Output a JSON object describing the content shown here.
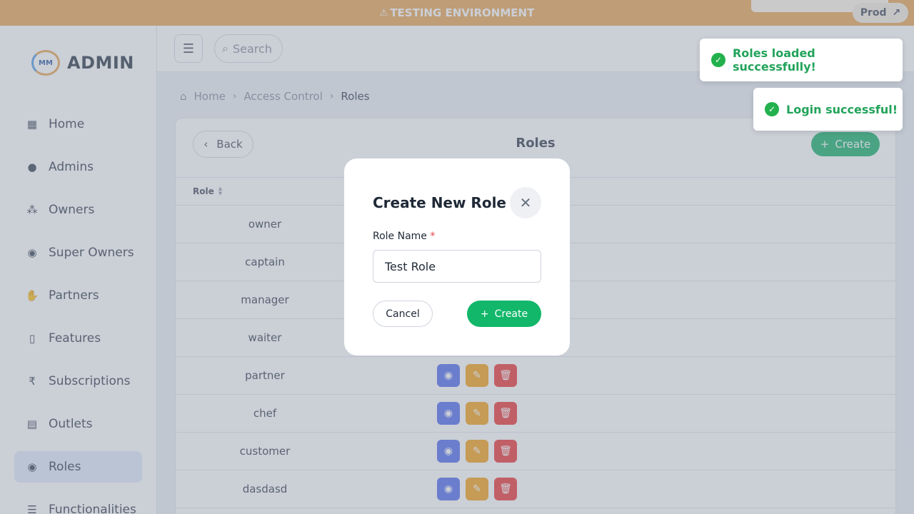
{
  "banner": {
    "text": "TESTING ENVIRONMENT",
    "env_button": "Prod"
  },
  "brand": {
    "logo_text": "MM",
    "name": "ADMIN"
  },
  "sidebar": {
    "items": [
      {
        "label": "Home",
        "icon": "grid-icon"
      },
      {
        "label": "Admins",
        "icon": "user-icon"
      },
      {
        "label": "Owners",
        "icon": "users-icon"
      },
      {
        "label": "Super Owners",
        "icon": "user-shield-icon"
      },
      {
        "label": "Partners",
        "icon": "handshake-icon"
      },
      {
        "label": "Features",
        "icon": "mobile-icon"
      },
      {
        "label": "Subscriptions",
        "icon": "rupee-icon"
      },
      {
        "label": "Outlets",
        "icon": "store-icon"
      },
      {
        "label": "Roles",
        "icon": "user-shield-icon",
        "active": true
      },
      {
        "label": "Functionalities",
        "icon": "list-icon"
      }
    ]
  },
  "topbar": {
    "search_placeholder": "Search"
  },
  "breadcrumb": {
    "home": "Home",
    "section": "Access Control",
    "current": "Roles"
  },
  "page": {
    "title": "Roles",
    "back_label": "Back",
    "create_label": "Create"
  },
  "table": {
    "column": "Role",
    "rows": [
      "owner",
      "captain",
      "manager",
      "waiter",
      "partner",
      "chef",
      "customer",
      "dasdasd"
    ]
  },
  "modal": {
    "title": "Create New Role",
    "field_label": "Role Name",
    "required_mark": "*",
    "field_value": "Test Role",
    "cancel_label": "Cancel",
    "create_label": "Create"
  },
  "toasts": [
    {
      "text": "Roles loaded successfully!"
    },
    {
      "text": "Login successful!"
    }
  ],
  "colors": {
    "banner": "#e9a95c",
    "primary_green": "#12b76a",
    "view": "#5b73f0",
    "edit": "#f5a623",
    "delete": "#ee3f3f",
    "active_nav": "#e3ecfb"
  }
}
